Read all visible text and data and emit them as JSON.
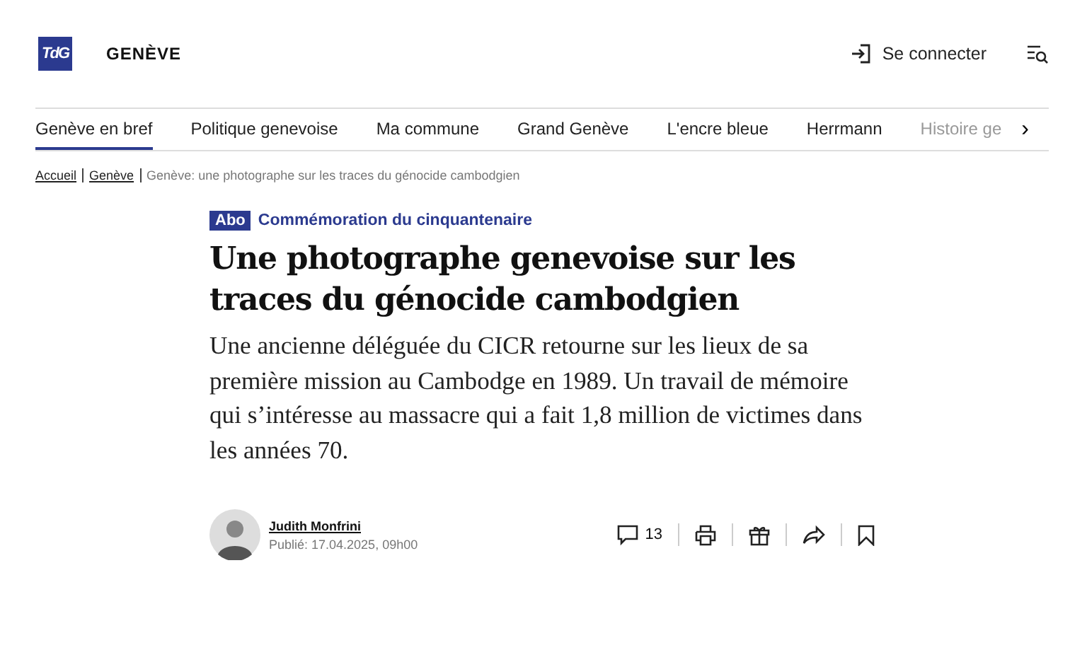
{
  "header": {
    "logo": "TdG",
    "section": "GENÈVE",
    "login": "Se connecter"
  },
  "nav": [
    {
      "label": "Genève en bref",
      "selected": true
    },
    {
      "label": "Politique genevoise",
      "selected": false
    },
    {
      "label": "Ma commune",
      "selected": false
    },
    {
      "label": "Grand Genève",
      "selected": false
    },
    {
      "label": "L'encre bleue",
      "selected": false
    },
    {
      "label": "Herrmann",
      "selected": false
    },
    {
      "label": "Histoire ge",
      "selected": false
    }
  ],
  "nav_next": "›",
  "breadcrumb": {
    "links": [
      "Accueil",
      "Genève"
    ],
    "current": "Genève: une photographe sur les traces du génocide cambodgien"
  },
  "article": {
    "badge": "Abo",
    "kicker": "Commémoration du cinquantenaire",
    "title": "Une photographe genevoise sur les traces du génocide cambodgien",
    "lead": "Une ancienne déléguée du CICR retourne sur les lieux de sa première mission au Cambodge en 1989. Un travail de mémoire qui s’intéresse au massacre qui a fait 1,8 million de victimes dans les années 70.",
    "author": "Judith Monfrini",
    "published": "Publié: 17.04.2025, 09h00",
    "comments": "13"
  }
}
